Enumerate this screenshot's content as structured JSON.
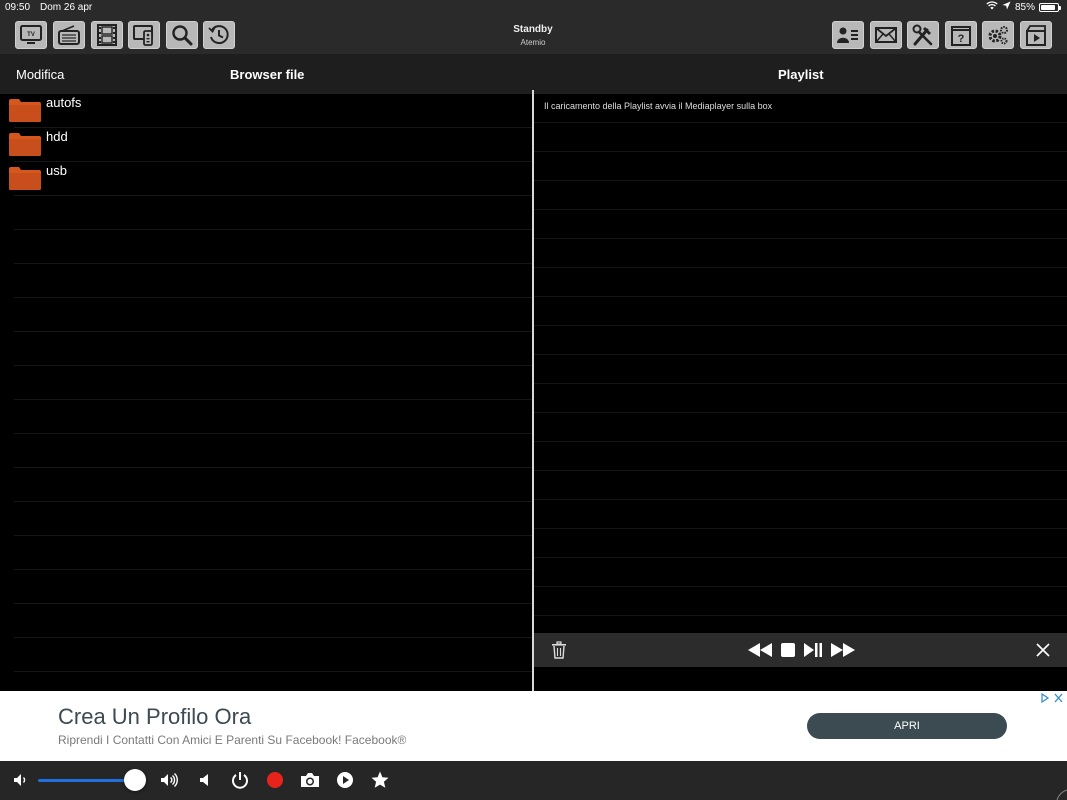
{
  "status_bar": {
    "time": "09:50",
    "date": "Dom 26 apr",
    "battery": "85%",
    "battery_level": 0.85
  },
  "toolbar": {
    "left_icons": [
      "tv-icon",
      "radio-icon",
      "film-icon",
      "remote-icon",
      "search-icon",
      "history-icon"
    ],
    "title": "Standby",
    "subtitle": "Atemio",
    "right_icons": [
      "contacts-icon",
      "mail-icon",
      "tools-icon",
      "help-icon",
      "settings-icon",
      "media-icon"
    ]
  },
  "header": {
    "edit_label": "Modifica",
    "browser_title": "Browser file",
    "playlist_title": "Playlist"
  },
  "browser": {
    "items": [
      {
        "name": "autofs",
        "icon": "folder-icon"
      },
      {
        "name": "hdd",
        "icon": "folder-icon"
      },
      {
        "name": "usb",
        "icon": "folder-icon"
      }
    ]
  },
  "playlist": {
    "info_text": "Il caricamento della Playlist avvia il Mediaplayer sulla box",
    "controls": [
      "trash-icon",
      "rewind-icon",
      "stop-icon",
      "play-pause-icon",
      "fast-forward-icon",
      "close-icon"
    ]
  },
  "ad": {
    "title": "Crea Un Profilo Ora",
    "subtitle": "Riprendi I Contatti Con Amici E Parenti Su Facebook! Facebook®",
    "button": "APRI"
  },
  "bottom": {
    "volume_level": 0.95,
    "icons": [
      "volume-low-icon",
      "volume-high-icon",
      "mute-icon",
      "power-icon",
      "record-icon",
      "camera-icon",
      "play-icon",
      "star-icon"
    ],
    "record_color": "#e8231c",
    "slider_color": "#1f6fe0"
  },
  "colors": {
    "folder": "#d4571e",
    "toolbar_button": "#b8b8b8"
  }
}
